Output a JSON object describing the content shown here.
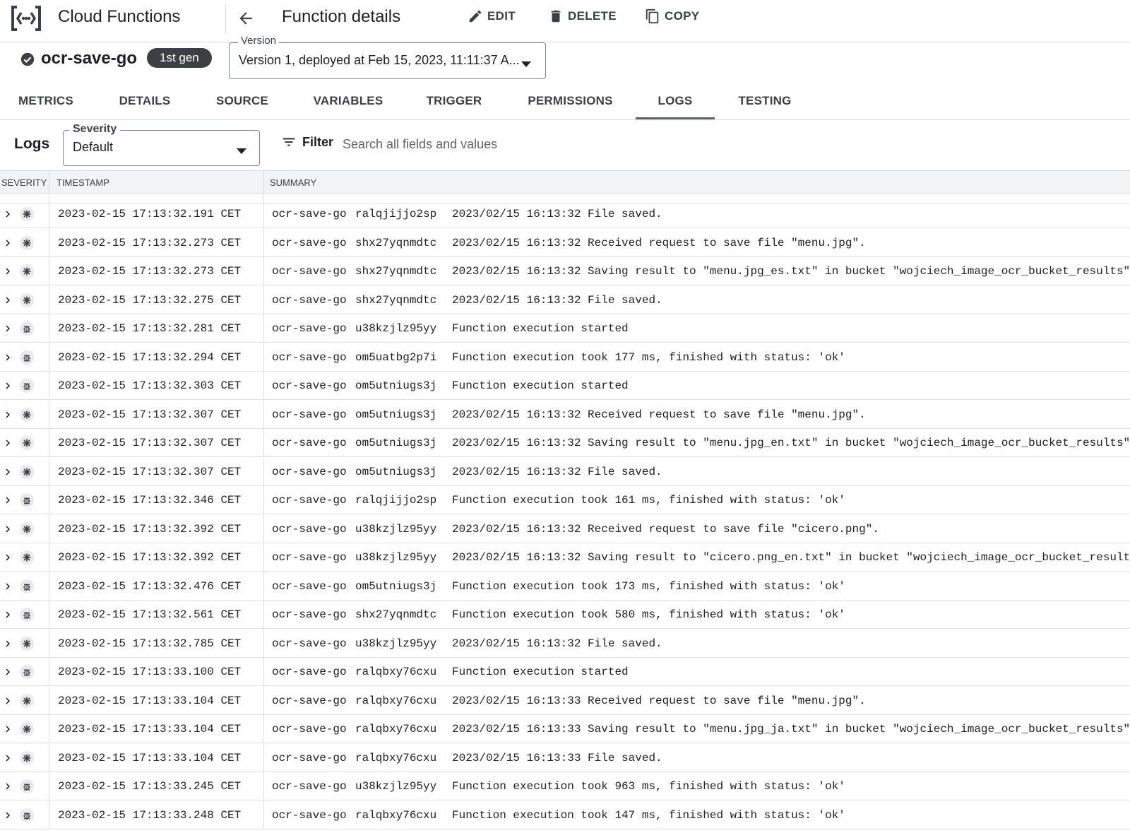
{
  "header": {
    "product_title": "Cloud Functions",
    "page_title": "Function details",
    "actions": {
      "edit": "EDIT",
      "delete": "DELETE",
      "copy": "COPY"
    }
  },
  "function": {
    "name": "ocr-save-go",
    "gen_badge": "1st gen",
    "version_label": "Version",
    "version_value": "Version 1, deployed at Feb 15, 2023, 11:11:37 A..."
  },
  "tabs": [
    {
      "label": "METRICS"
    },
    {
      "label": "DETAILS"
    },
    {
      "label": "SOURCE"
    },
    {
      "label": "VARIABLES"
    },
    {
      "label": "TRIGGER"
    },
    {
      "label": "PERMISSIONS"
    },
    {
      "label": "LOGS"
    },
    {
      "label": "TESTING"
    }
  ],
  "active_tab": "LOGS",
  "logs": {
    "title": "Logs",
    "severity_label": "Severity",
    "severity_value": "Default",
    "filter_label": "Filter",
    "search_placeholder": "Search all fields and values",
    "columns": {
      "severity": "SEVERITY",
      "timestamp": "TIMESTAMP",
      "summary": "SUMMARY"
    },
    "rows": [
      {
        "severity": "default",
        "timestamp": "2023-02-15 17:13:32.191 CET",
        "function": "ocr-save-go",
        "execution_id": "ralqjijjo2sp",
        "message": "2023/02/15 16:13:32 File saved."
      },
      {
        "severity": "default",
        "timestamp": "2023-02-15 17:13:32.273 CET",
        "function": "ocr-save-go",
        "execution_id": "shx27yqnmdtc",
        "message": "2023/02/15 16:13:32 Received request to save file \"menu.jpg\"."
      },
      {
        "severity": "default",
        "timestamp": "2023-02-15 17:13:32.273 CET",
        "function": "ocr-save-go",
        "execution_id": "shx27yqnmdtc",
        "message": "2023/02/15 16:13:32 Saving result to \"menu.jpg_es.txt\" in bucket \"wojciech_image_ocr_bucket_results\"."
      },
      {
        "severity": "default",
        "timestamp": "2023-02-15 17:13:32.275 CET",
        "function": "ocr-save-go",
        "execution_id": "shx27yqnmdtc",
        "message": "2023/02/15 16:13:32 File saved."
      },
      {
        "severity": "debug",
        "timestamp": "2023-02-15 17:13:32.281 CET",
        "function": "ocr-save-go",
        "execution_id": "u38kzjlz95yy",
        "message": "Function execution started"
      },
      {
        "severity": "debug",
        "timestamp": "2023-02-15 17:13:32.294 CET",
        "function": "ocr-save-go",
        "execution_id": "om5uatbg2p7i",
        "message": "Function execution took 177 ms, finished with status: 'ok'"
      },
      {
        "severity": "debug",
        "timestamp": "2023-02-15 17:13:32.303 CET",
        "function": "ocr-save-go",
        "execution_id": "om5utniugs3j",
        "message": "Function execution started"
      },
      {
        "severity": "default",
        "timestamp": "2023-02-15 17:13:32.307 CET",
        "function": "ocr-save-go",
        "execution_id": "om5utniugs3j",
        "message": "2023/02/15 16:13:32 Received request to save file \"menu.jpg\"."
      },
      {
        "severity": "default",
        "timestamp": "2023-02-15 17:13:32.307 CET",
        "function": "ocr-save-go",
        "execution_id": "om5utniugs3j",
        "message": "2023/02/15 16:13:32 Saving result to \"menu.jpg_en.txt\" in bucket \"wojciech_image_ocr_bucket_results\"."
      },
      {
        "severity": "default",
        "timestamp": "2023-02-15 17:13:32.307 CET",
        "function": "ocr-save-go",
        "execution_id": "om5utniugs3j",
        "message": "2023/02/15 16:13:32 File saved."
      },
      {
        "severity": "debug",
        "timestamp": "2023-02-15 17:13:32.346 CET",
        "function": "ocr-save-go",
        "execution_id": "ralqjijjo2sp",
        "message": "Function execution took 161 ms, finished with status: 'ok'"
      },
      {
        "severity": "default",
        "timestamp": "2023-02-15 17:13:32.392 CET",
        "function": "ocr-save-go",
        "execution_id": "u38kzjlz95yy",
        "message": "2023/02/15 16:13:32 Received request to save file \"cicero.png\"."
      },
      {
        "severity": "default",
        "timestamp": "2023-02-15 17:13:32.392 CET",
        "function": "ocr-save-go",
        "execution_id": "u38kzjlz95yy",
        "message": "2023/02/15 16:13:32 Saving result to \"cicero.png_en.txt\" in bucket \"wojciech_image_ocr_bucket_results\"."
      },
      {
        "severity": "debug",
        "timestamp": "2023-02-15 17:13:32.476 CET",
        "function": "ocr-save-go",
        "execution_id": "om5utniugs3j",
        "message": "Function execution took 173 ms, finished with status: 'ok'"
      },
      {
        "severity": "debug",
        "timestamp": "2023-02-15 17:13:32.561 CET",
        "function": "ocr-save-go",
        "execution_id": "shx27yqnmdtc",
        "message": "Function execution took 580 ms, finished with status: 'ok'"
      },
      {
        "severity": "default",
        "timestamp": "2023-02-15 17:13:32.785 CET",
        "function": "ocr-save-go",
        "execution_id": "u38kzjlz95yy",
        "message": "2023/02/15 16:13:32 File saved."
      },
      {
        "severity": "debug",
        "timestamp": "2023-02-15 17:13:33.100 CET",
        "function": "ocr-save-go",
        "execution_id": "ralqbxy76cxu",
        "message": "Function execution started"
      },
      {
        "severity": "default",
        "timestamp": "2023-02-15 17:13:33.104 CET",
        "function": "ocr-save-go",
        "execution_id": "ralqbxy76cxu",
        "message": "2023/02/15 16:13:33 Received request to save file \"menu.jpg\"."
      },
      {
        "severity": "default",
        "timestamp": "2023-02-15 17:13:33.104 CET",
        "function": "ocr-save-go",
        "execution_id": "ralqbxy76cxu",
        "message": "2023/02/15 16:13:33 Saving result to \"menu.jpg_ja.txt\" in bucket \"wojciech_image_ocr_bucket_results\"."
      },
      {
        "severity": "default",
        "timestamp": "2023-02-15 17:13:33.104 CET",
        "function": "ocr-save-go",
        "execution_id": "ralqbxy76cxu",
        "message": "2023/02/15 16:13:33 File saved."
      },
      {
        "severity": "debug",
        "timestamp": "2023-02-15 17:13:33.245 CET",
        "function": "ocr-save-go",
        "execution_id": "u38kzjlz95yy",
        "message": "Function execution took 963 ms, finished with status: 'ok'"
      },
      {
        "severity": "debug",
        "timestamp": "2023-02-15 17:13:33.248 CET",
        "function": "ocr-save-go",
        "execution_id": "ralqbxy76cxu",
        "message": "Function execution took 147 ms, finished with status: 'ok'"
      }
    ]
  },
  "colors": {
    "text": "#202124",
    "divider": "#dadce0",
    "badge_bg": "#3c4043",
    "header_bg": "#f1f3f4"
  }
}
